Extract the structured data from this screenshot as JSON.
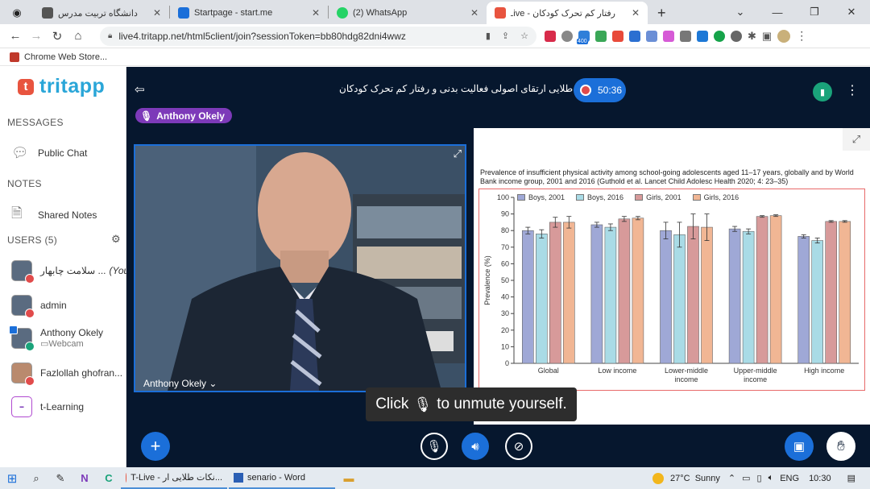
{
  "browser": {
    "tabs": [
      {
        "title": "دانشگاه تربیت مدرس",
        "icon": "globe-icon",
        "color": "#4a4a4a"
      },
      {
        "title": "Startpage - start.me",
        "icon": "startme-icon",
        "color": "#1b6fd9"
      },
      {
        "title": "(2) WhatsApp",
        "icon": "whatsapp-icon",
        "color": "#25d366"
      },
      {
        "title": "رفتار کم تحرک کودکان - T-Live",
        "icon": "tlive-icon",
        "color": "#e8543f"
      }
    ],
    "new_tab": "+",
    "url": "live4.tritapp.net/html5client/join?sessionToken=bb80hdg82dni4wwz",
    "bookmark": "Chrome Web Store...",
    "ext_badge": "400"
  },
  "sidebar": {
    "logo_mark": "t",
    "logo_text": "tritapp",
    "messages_heading": "MESSAGES",
    "public_chat": "Public Chat",
    "notes_heading": "NOTES",
    "shared_notes": "Shared Notes",
    "users_heading": "USERS (5)",
    "users": [
      {
        "name": "... سلامت چابهار",
        "tag": "(You)"
      },
      {
        "name": "admin"
      },
      {
        "name": "Anthony Okely",
        "sub": "Webcam"
      },
      {
        "name": "Fazlollah ghofran..."
      },
      {
        "name": "t-Learning"
      }
    ]
  },
  "meeting": {
    "title": "نکات طلایی ارتقای اصولی فعالیت بدنی و رفتار کم تحرک کودکان",
    "timer": "50:36",
    "speaker": "Anthony Okely",
    "video_name": "Anthony Okely",
    "toast_before": "Click",
    "toast_after": "to unmute yourself."
  },
  "chart_data": {
    "type": "bar",
    "title": "Prevalence of insufficient physical activity among school-going adolescents aged 11–17 years, globally and by World Bank income group, 2001 and 2016 (Guthold et al. Lancet Child Adolesc Health 2020; 4: 23–35)",
    "ylabel": "Prevalence (%)",
    "ylim": [
      0,
      100
    ],
    "yticks": [
      0,
      10,
      20,
      30,
      40,
      50,
      60,
      70,
      80,
      90,
      100
    ],
    "categories": [
      "Global",
      "Low income",
      "Lower-middle income",
      "Upper-middle income",
      "High income"
    ],
    "category_labels": [
      [
        "Global"
      ],
      [
        "Low income"
      ],
      [
        "Lower-middle",
        "income"
      ],
      [
        "Upper-middle",
        "income"
      ],
      [
        "High income"
      ]
    ],
    "series": [
      {
        "name": "Boys, 2001",
        "color": "#9fa8d6",
        "values": [
          80,
          83.5,
          80,
          81,
          76.5
        ],
        "errors": [
          2,
          1.5,
          5,
          1.5,
          1
        ]
      },
      {
        "name": "Boys, 2016",
        "color": "#a9dbe6",
        "values": [
          78,
          82,
          77.5,
          79.5,
          74
        ],
        "errors": [
          2.5,
          2,
          7.5,
          1.5,
          1.5
        ]
      },
      {
        "name": "Girls, 2001",
        "color": "#d79a9a",
        "values": [
          85,
          87,
          82.5,
          88.5,
          85.5
        ],
        "errors": [
          3,
          1.5,
          7.5,
          0.5,
          0.5
        ]
      },
      {
        "name": "Girls, 2016",
        "color": "#f1b694",
        "values": [
          85,
          87.5,
          82,
          89,
          85.5
        ],
        "errors": [
          3.5,
          1,
          8,
          0.5,
          0.5
        ]
      }
    ]
  },
  "taskbar": {
    "apps": [
      "T-Live - نکات طلایی ار...",
      "senario - Word"
    ],
    "weather": "27°C  Sunny",
    "lang": "ENG",
    "time": "10:30"
  }
}
